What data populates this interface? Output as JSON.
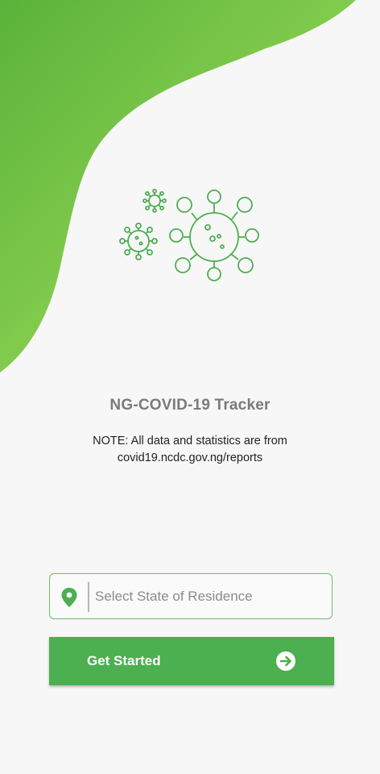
{
  "app": {
    "title": "NG-COVID-19 Tracker",
    "note": "NOTE: All data and statistics are from covid19.ncdc.gov.ng/reports"
  },
  "state_select": {
    "placeholder": "Select State of Residence",
    "icon": "location-pin-icon"
  },
  "cta": {
    "label": "Get Started",
    "icon": "arrow-right-circle-icon"
  },
  "colors": {
    "accent": "#4caf50",
    "blob_dark": "#5cb53b",
    "blob_light": "#a4df5e"
  },
  "illustration": {
    "icon": "virus-icon"
  }
}
